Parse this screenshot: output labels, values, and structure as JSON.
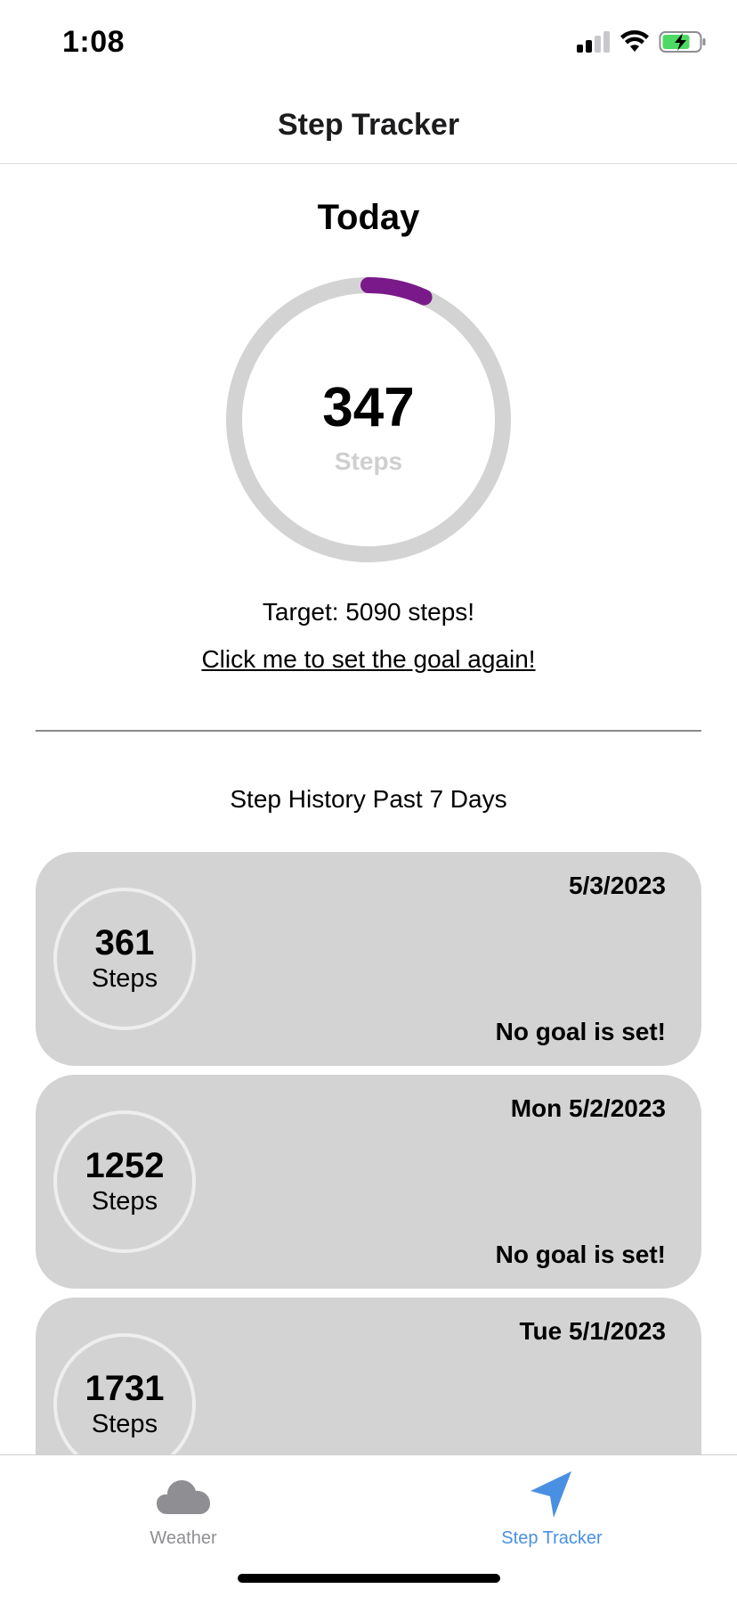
{
  "status_bar": {
    "time": "1:08"
  },
  "header": {
    "title": "Step Tracker"
  },
  "today": {
    "title": "Today",
    "steps": "347",
    "unit": "Steps",
    "target_text": "Target: 5090 steps!",
    "reset_link": "Click me to set the goal again!",
    "progress": 0.068
  },
  "history": {
    "title": "Step History Past 7 Days",
    "items": [
      {
        "date": "5/3/2023",
        "steps": "361",
        "unit": "Steps",
        "goal": "No goal is set!"
      },
      {
        "date": "Mon 5/2/2023",
        "steps": "1252",
        "unit": "Steps",
        "goal": "No goal is set!"
      },
      {
        "date": "Tue 5/1/2023",
        "steps": "1731",
        "unit": "Steps",
        "goal": ""
      }
    ]
  },
  "tabs": [
    {
      "label": "Weather",
      "icon": "cloud-icon",
      "active": false
    },
    {
      "label": "Step Tracker",
      "icon": "location-arrow-icon",
      "active": true
    }
  ],
  "colors": {
    "progress": "#7a1a8a",
    "ring_track": "#d3d3d3",
    "card": "#d3d3d3",
    "tab_active": "#4a90e2",
    "tab_inactive": "#8e8e93",
    "battery": "#4cd964"
  }
}
